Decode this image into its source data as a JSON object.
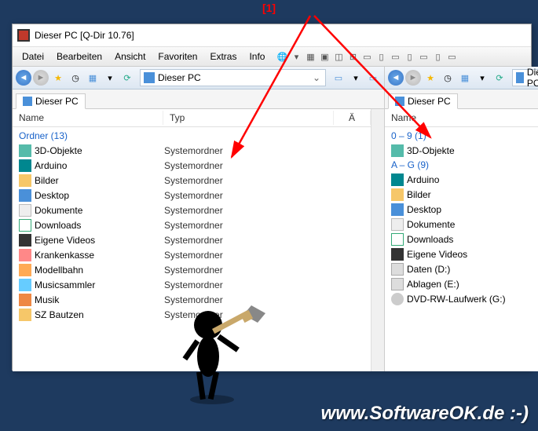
{
  "annotation": "[1]",
  "window": {
    "title": "Dieser PC  [Q-Dir 10.76]"
  },
  "menubar": [
    "Datei",
    "Bearbeiten",
    "Ansicht",
    "Favoriten",
    "Extras",
    "Info"
  ],
  "address_label": "Dieser PC",
  "tab_label": "Dieser PC",
  "left_pane": {
    "columns": {
      "name": "Name",
      "typ": "Typ",
      "a": "Ä"
    },
    "group": "Ordner (13)",
    "rows": [
      {
        "name": "3D-Objekte",
        "typ": "Systemordner",
        "ic": "ic-3d"
      },
      {
        "name": "Arduino",
        "typ": "Systemordner",
        "ic": "ic-arduino"
      },
      {
        "name": "Bilder",
        "typ": "Systemordner",
        "ic": "ic-folder"
      },
      {
        "name": "Desktop",
        "typ": "Systemordner",
        "ic": "ic-desktop"
      },
      {
        "name": "Dokumente",
        "typ": "Systemordner",
        "ic": "ic-doc"
      },
      {
        "name": "Downloads",
        "typ": "Systemordner",
        "ic": "ic-down"
      },
      {
        "name": "Eigene Videos",
        "typ": "Systemordner",
        "ic": "ic-video"
      },
      {
        "name": "Krankenkasse",
        "typ": "Systemordner",
        "ic": "ic-health"
      },
      {
        "name": "Modellbahn",
        "typ": "Systemordner",
        "ic": "ic-train"
      },
      {
        "name": "Musicsammler",
        "typ": "Systemordner",
        "ic": "ic-music"
      },
      {
        "name": "Musik",
        "typ": "Systemordner",
        "ic": "ic-music2"
      },
      {
        "name": "SZ Bautzen",
        "typ": "Systemordner",
        "ic": "ic-folder"
      }
    ]
  },
  "right_pane": {
    "columns": {
      "name": "Name"
    },
    "groups": [
      {
        "label": "0 – 9 (1)",
        "rows": [
          {
            "name": "3D-Objekte",
            "ic": "ic-3d"
          }
        ]
      },
      {
        "label": "A – G (9)",
        "rows": [
          {
            "name": "Arduino",
            "ic": "ic-arduino"
          },
          {
            "name": "Bilder",
            "ic": "ic-folder"
          },
          {
            "name": "Desktop",
            "ic": "ic-desktop"
          },
          {
            "name": "Dokumente",
            "ic": "ic-doc"
          },
          {
            "name": "Downloads",
            "ic": "ic-down"
          },
          {
            "name": "Eigene Videos",
            "ic": "ic-video"
          },
          {
            "name": "Daten (D:)",
            "ic": "ic-drive"
          },
          {
            "name": "Ablagen (E:)",
            "ic": "ic-drive"
          },
          {
            "name": "DVD-RW-Laufwerk (G:)",
            "ic": "ic-dvd"
          }
        ]
      }
    ]
  },
  "footer": "www.SoftwareOK.de :-)"
}
